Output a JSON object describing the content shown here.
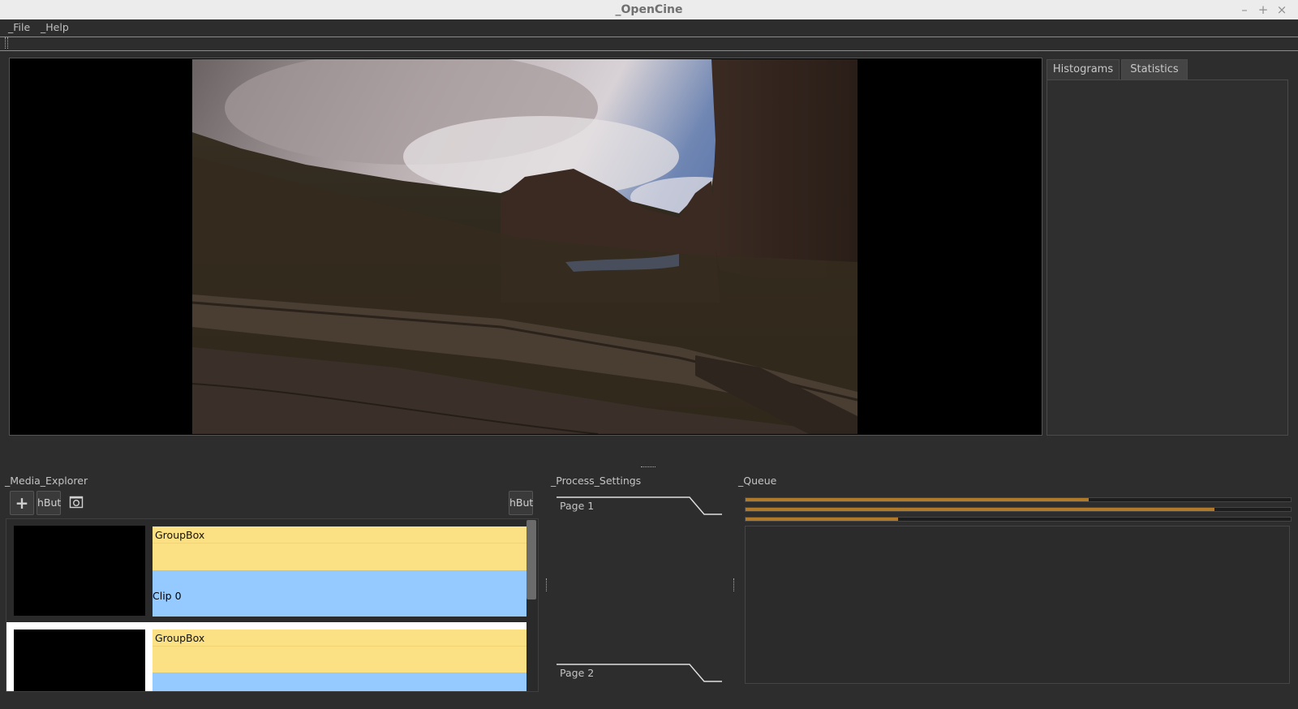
{
  "window": {
    "title": "_OpenCine",
    "controls": {
      "minimize": "–",
      "maximize": "+",
      "close": "×"
    }
  },
  "menu": {
    "file": "_File",
    "help": "_Help"
  },
  "tabs": [
    {
      "label": "Histograms"
    },
    {
      "label": "Statistics"
    }
  ],
  "media_explorer": {
    "title": "_Media_Explorer",
    "add_button": "+",
    "h_button_1": "hBut",
    "h_button_2": "hBut",
    "clips": [
      {
        "group_label": "GroupBox",
        "clip_label": "Clip 0"
      },
      {
        "group_label": "GroupBox",
        "clip_label": ""
      }
    ]
  },
  "process_settings": {
    "title": "_Process_Settings",
    "pages": [
      "Page 1",
      "Page 2"
    ]
  },
  "queue": {
    "title": "_Queue",
    "progress": [
      0.63,
      0.86,
      0.28
    ],
    "progress_color": "#b07a2a"
  }
}
